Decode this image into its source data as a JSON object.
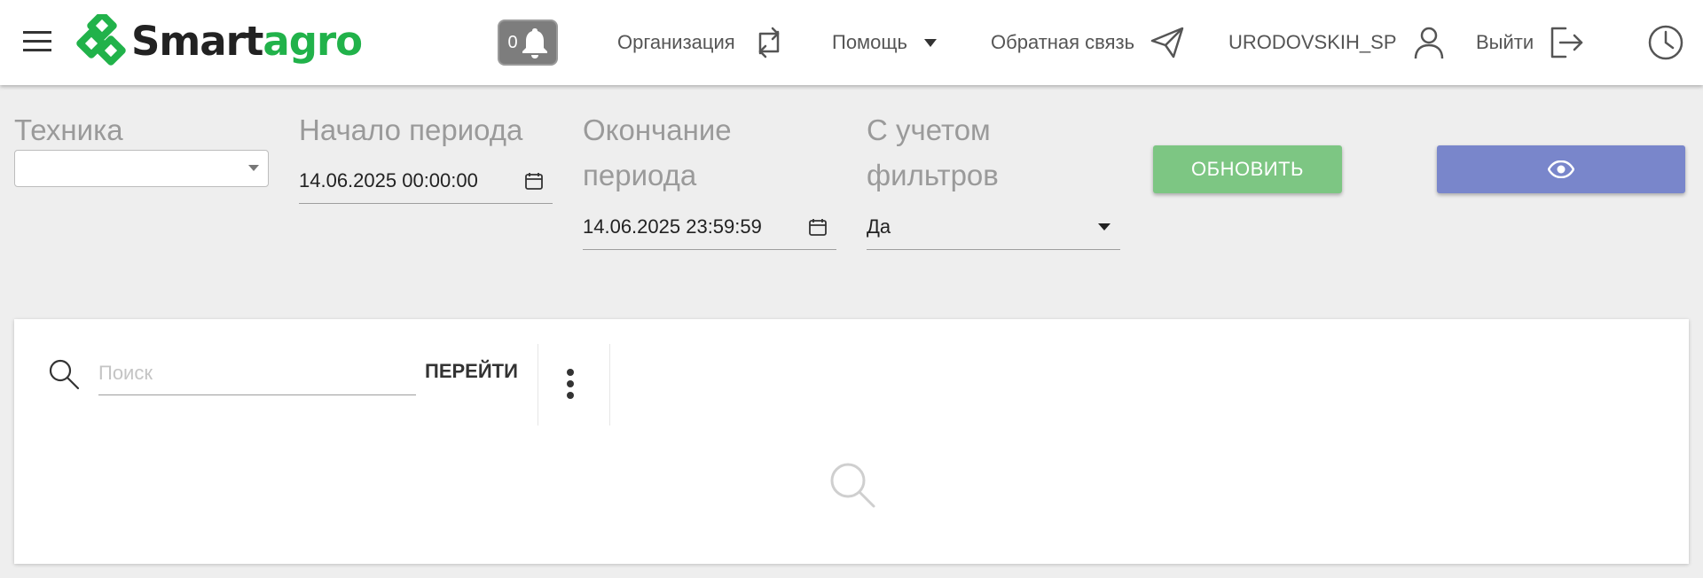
{
  "header": {
    "logo_part1": "Smart",
    "logo_part2": "agro",
    "notifications_count": "0",
    "organization_label": "Организация",
    "help_label": "Помощь",
    "feedback_label": "Обратная связь",
    "username": "URODOVSKIH_SP",
    "logout_label": "Выйти",
    "icons": [
      "menu-icon",
      "bell-icon",
      "swap-icon",
      "dropdown-caret-icon",
      "send-icon",
      "user-icon",
      "logout-icon",
      "clock-icon"
    ]
  },
  "filters": {
    "machinery_label": "Техника",
    "machinery_value": "",
    "start_label": "Начало периода",
    "start_value": "14.06.2025 00:00:00",
    "end_label_line1": "Окончание",
    "end_label_line2": "периода",
    "end_value": "14.06.2025 23:59:59",
    "with_filters_label_line1": "С учетом",
    "with_filters_label_line2": "фильтров",
    "with_filters_value": "Да",
    "refresh_label": "ОБНОВИТЬ"
  },
  "panel": {
    "search_placeholder": "Поиск",
    "search_value": "",
    "goto_label": "ПЕРЕЙТИ"
  },
  "colors": {
    "brand_green": "#21b24a",
    "refresh_button": "#7dc683",
    "view_button": "#7986cb",
    "notification_badge": "#7d7d7d"
  }
}
